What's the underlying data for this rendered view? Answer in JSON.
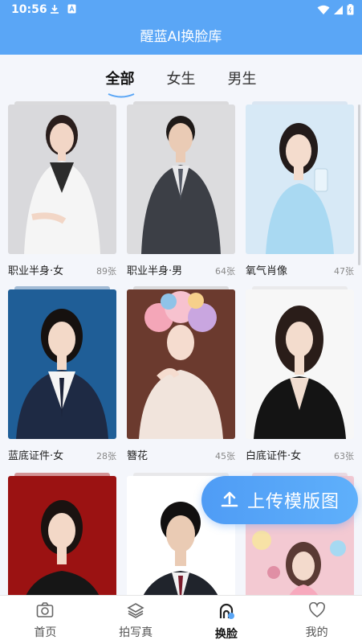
{
  "status_bar": {
    "time": "10:56"
  },
  "app_bar": {
    "title": "醒蓝AI换脸库"
  },
  "tabs": [
    {
      "label": "全部",
      "active": true
    },
    {
      "label": "女生",
      "active": false
    },
    {
      "label": "男生",
      "active": false
    }
  ],
  "cards": [
    {
      "name": "职业半身·女",
      "count": "89张"
    },
    {
      "name": "职业半身·男",
      "count": "64张"
    },
    {
      "name": "氧气肖像",
      "count": "47张"
    },
    {
      "name": "蓝底证件·女",
      "count": "28张"
    },
    {
      "name": "簪花",
      "count": "45张"
    },
    {
      "name": "白底证件·女",
      "count": "63张"
    },
    {
      "name": "",
      "count": ""
    },
    {
      "name": "",
      "count": ""
    },
    {
      "name": "",
      "count": ""
    }
  ],
  "upload_button": {
    "label": "上传模版图"
  },
  "bottom_nav": [
    {
      "label": "首页",
      "icon": "camera-icon",
      "active": false
    },
    {
      "label": "拍写真",
      "icon": "layers-icon",
      "active": false
    },
    {
      "label": "换脸",
      "icon": "face-swap-icon",
      "active": true
    },
    {
      "label": "我的",
      "icon": "heart-icon",
      "active": false
    }
  ],
  "colors": {
    "accent": "#5aa6f6",
    "background": "#f4f6fb"
  }
}
